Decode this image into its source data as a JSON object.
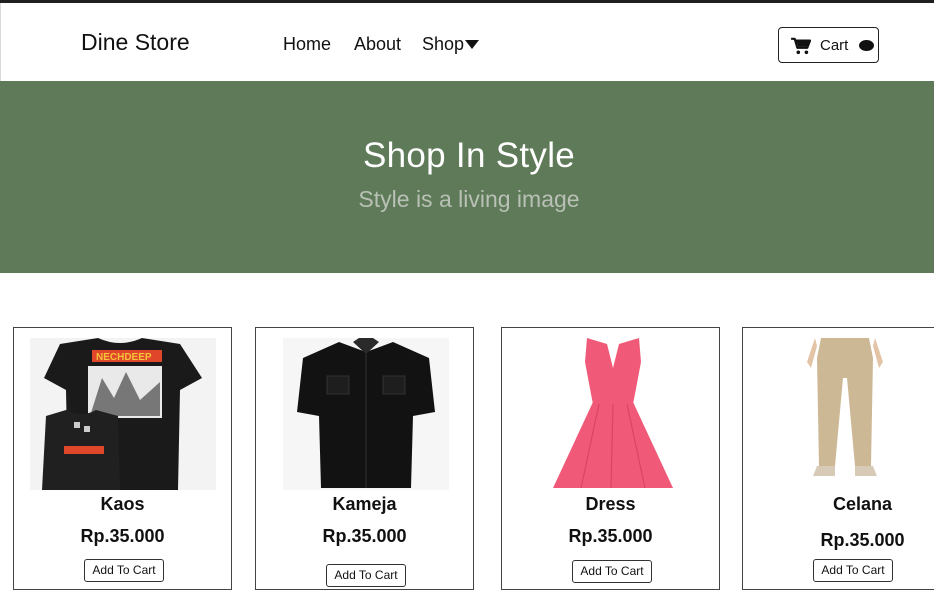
{
  "brand": "Dine Store",
  "nav": {
    "home": "Home",
    "about": "About",
    "shop": "Shop"
  },
  "cart": {
    "label": "Cart"
  },
  "hero": {
    "title": "Shop In Style",
    "subtitle": "Style is a living image"
  },
  "products": [
    {
      "name": "Kaos",
      "price": "Rp.35.000",
      "button": "Add To Cart"
    },
    {
      "name": "Kameja",
      "price": "Rp.35.000",
      "button": "Add To Cart"
    },
    {
      "name": "Dress",
      "price": "Rp.35.000",
      "button": "Add To Cart"
    },
    {
      "name": "Celana",
      "price": "Rp.35.000",
      "button": "Add To Cart"
    }
  ],
  "tshirt_print": "NECHDEEP",
  "colors": {
    "hero_bg": "#5e7a58",
    "dress": "#f05a78",
    "pants": "#cdb896"
  }
}
